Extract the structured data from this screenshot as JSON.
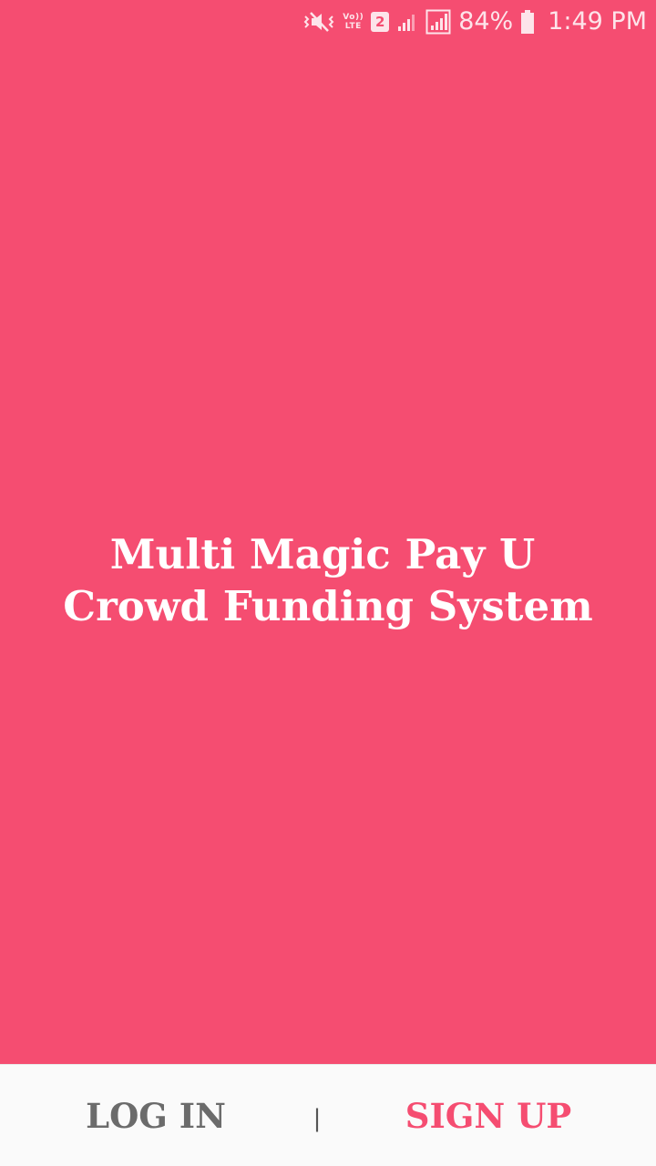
{
  "status_bar": {
    "icons": [
      "vibrate-mute-icon",
      "volte-lte-icon",
      "sim-2-icon",
      "signal-icon",
      "signal-box-icon",
      "battery-icon"
    ],
    "volte_top": "Vo))",
    "volte_bottom": "LTE",
    "sim_number": "2",
    "battery_percent": "84%",
    "time": "1:49 PM"
  },
  "main": {
    "title_line_1": "Multi Magic Pay U",
    "title_line_2": "Crowd Funding System"
  },
  "bottom_bar": {
    "login_label": "LOG IN",
    "divider": "|",
    "signup_label": "SIGN UP"
  },
  "colors": {
    "background": "#F54D71",
    "bottom_bar": "#fafafa",
    "login_text": "#6b6b6b",
    "signup_text": "#F54D71",
    "title_text": "#ffffff"
  }
}
